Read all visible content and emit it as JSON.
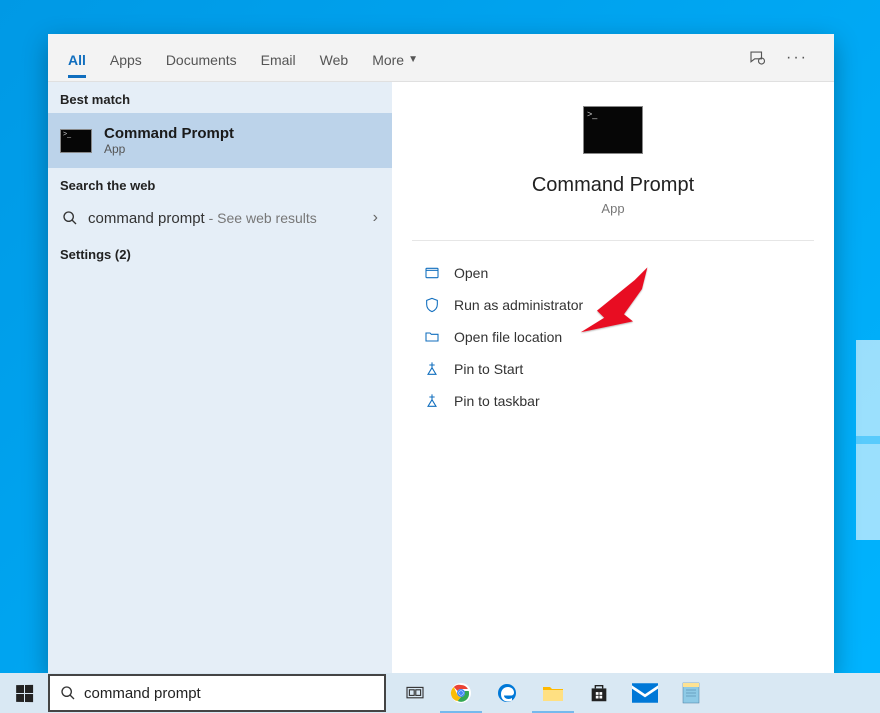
{
  "tabs": {
    "all": "All",
    "apps": "Apps",
    "documents": "Documents",
    "email": "Email",
    "web": "Web",
    "more": "More"
  },
  "left": {
    "best_match_label": "Best match",
    "best_match": {
      "title": "Command Prompt",
      "subtitle": "App"
    },
    "search_web_label": "Search the web",
    "web_query": "command prompt",
    "web_suffix": " - See web results",
    "settings_label": "Settings (2)"
  },
  "detail": {
    "title": "Command Prompt",
    "subtitle": "App",
    "actions": {
      "open": "Open",
      "run_admin": "Run as administrator",
      "open_location": "Open file location",
      "pin_start": "Pin to Start",
      "pin_taskbar": "Pin to taskbar"
    }
  },
  "taskbar": {
    "search_value": "command prompt"
  }
}
